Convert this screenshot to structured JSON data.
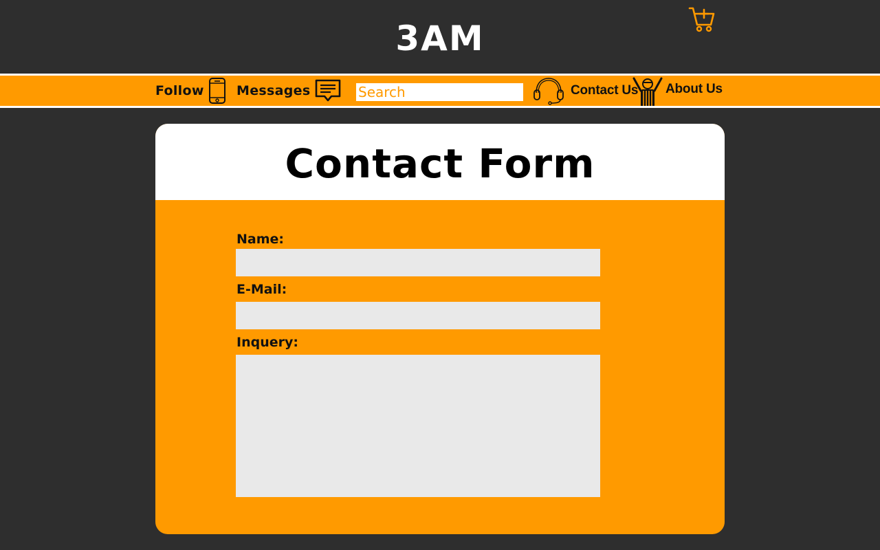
{
  "header": {
    "logo": "3AM",
    "cart_icon": "cart-add-icon"
  },
  "nav": {
    "follow_label": "Follow",
    "follow_icon": "smartphone-icon",
    "messages_label": "Messages",
    "messages_icon": "message-icon",
    "search_placeholder": "Search",
    "contact_label": "Contact Us",
    "contact_icon": "headset-icon",
    "about_label": "About Us",
    "about_icon": "referee-icon"
  },
  "form": {
    "title": "Contact Form",
    "name_label": "Name:",
    "name_value": "",
    "email_label": "E-Mail:",
    "email_value": "",
    "inquiry_label": "Inquery:",
    "inquiry_value": ""
  },
  "colors": {
    "background": "#2e2e2e",
    "accent": "#ff9a00",
    "field": "#e9e9e9",
    "white": "#ffffff"
  }
}
